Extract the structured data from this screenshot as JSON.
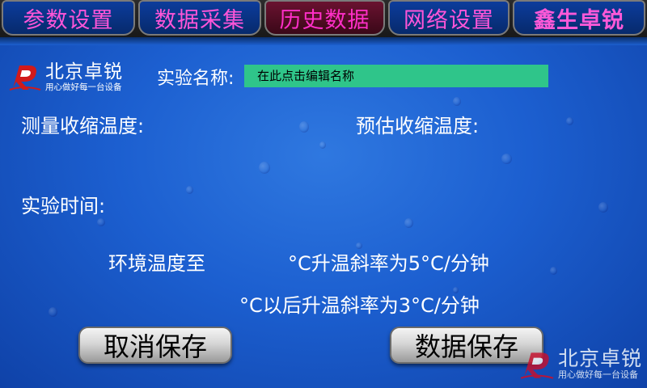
{
  "tabs": [
    {
      "label": "参数设置"
    },
    {
      "label": "数据采集"
    },
    {
      "label": "历史数据"
    },
    {
      "label": "网络设置"
    },
    {
      "label": "鑫生卓锐"
    }
  ],
  "active_tab": "历史数据",
  "logo": {
    "title": "北京卓锐",
    "subtitle": "用心做好每一台设备"
  },
  "experiment": {
    "name_label": "实验名称:",
    "name_value": "在此点击编辑名称"
  },
  "fields": {
    "measured_shrink_label": "测量收缩温度:",
    "estimated_shrink_label": "预估收缩温度:",
    "time_label": "实验时间:"
  },
  "rates": {
    "line1_prefix": "环境温度至",
    "line1_suffix": "°C升温斜率为5°C/分钟",
    "line2": "°C以后升温斜率为3°C/分钟"
  },
  "buttons": {
    "cancel": "取消保存",
    "save": "数据保存"
  },
  "watermark": {
    "title": "北京卓锐",
    "subtitle": "用心做好每一台设备"
  },
  "colors": {
    "tab_text": "#ff55d8",
    "name_field": "#2fc58a",
    "background": "#1c5fd0"
  }
}
